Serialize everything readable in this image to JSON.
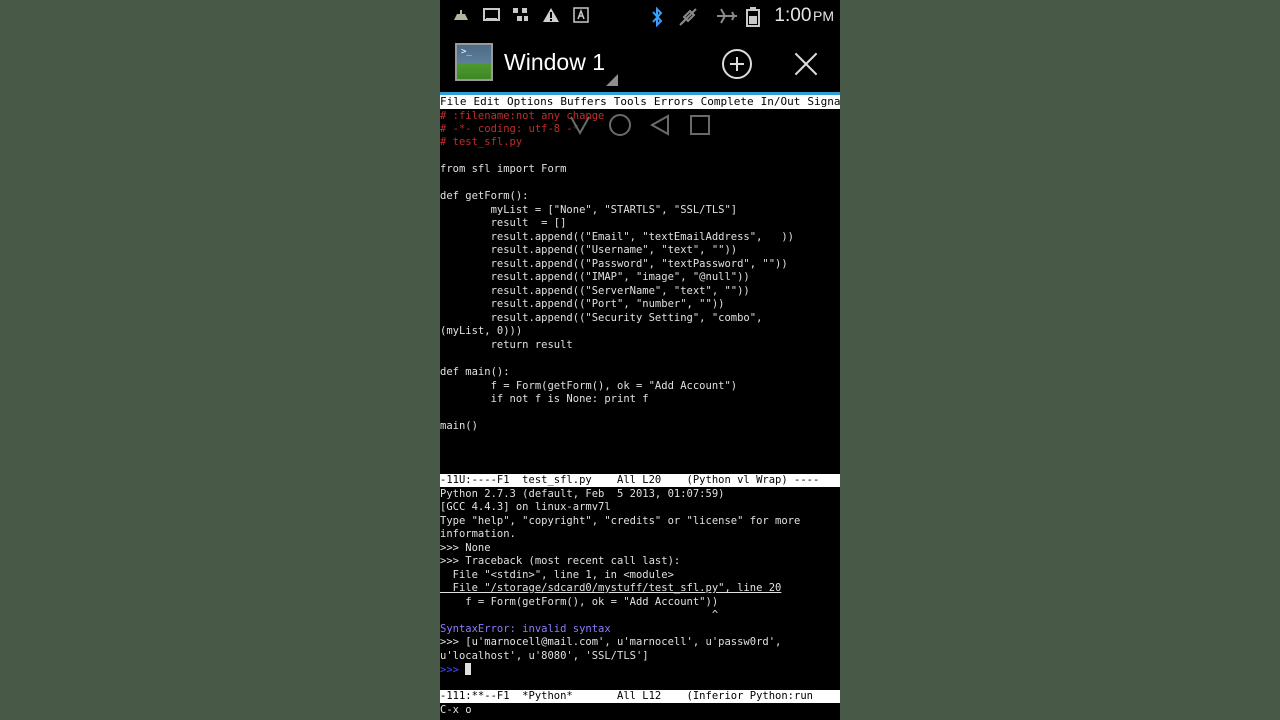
{
  "status_bar": {
    "time": "1:00",
    "ampm": "PM",
    "icons": [
      "usb-icon",
      "screenshot-icon",
      "network-icon",
      "warning-icon",
      "font-icon",
      "bluetooth-icon",
      "mute-icon",
      "airplane-icon",
      "battery-icon"
    ]
  },
  "window": {
    "title": "Window 1",
    "icon_prompt": ">_"
  },
  "menu": {
    "items": [
      "File",
      "Edit",
      "Options",
      "Buffers",
      "Tools",
      "Errors",
      "Complete",
      "In/Out",
      "Signa"
    ]
  },
  "editor": {
    "lines": [
      "# :filename:not any change",
      "# -*- coding: utf-8 -*-",
      "# test_sfl.py",
      "",
      "from sfl import Form",
      "",
      "def getForm():",
      "        myList = [\"None\", \"STARTLS\", \"SSL/TLS\"]",
      "        result  = []",
      "        result.append((\"Email\", \"textEmailAddress\",   ))",
      "        result.append((\"Username\", \"text\", \"\"))",
      "        result.append((\"Password\", \"textPassword\", \"\"))",
      "        result.append((\"IMAP\", \"image\", \"@null\"))",
      "        result.append((\"ServerName\", \"text\", \"\"))",
      "        result.append((\"Port\", \"number\", \"\"))",
      "        result.append((\"Security Setting\", \"combo\",",
      "(myList, 0)))",
      "        return result",
      "",
      "def main():",
      "        f = Form(getForm(), ok = \"Add Account\")",
      "        if not f is None: print f",
      "",
      "main()"
    ],
    "mode_line": "-11U:----F1  test_sfl.py    All L20    (Python vl Wrap) ----",
    "mode_buffer": "test_sfl.py"
  },
  "shell": {
    "lines": [
      "Python 2.7.3 (default, Feb  5 2013, 01:07:59)",
      "[GCC 4.4.3] on linux-armv7l",
      "Type \"help\", \"copyright\", \"credits\" or \"license\" for more",
      "information.",
      ">>> None",
      ">>> Traceback (most recent call last):",
      "  File \"<stdin>\", line 1, in <module>",
      "  File \"/storage/sdcard0/mystuff/test_sfl.py\", line 20",
      "    f = Form(getForm(), ok = \"Add Account\"))",
      "                                           ^",
      "SyntaxError: invalid syntax",
      ">>> [u'marnocell@mail.com', u'marnocell', u'passw0rd',",
      "u'localhost', u'8080', 'SSL/TLS']",
      ">>> "
    ],
    "mode_line": "-111:**--F1  *Python*       All L12    (Inferior Python:run",
    "mode_buffer": "*Python*"
  },
  "minibuffer": "C-x o"
}
